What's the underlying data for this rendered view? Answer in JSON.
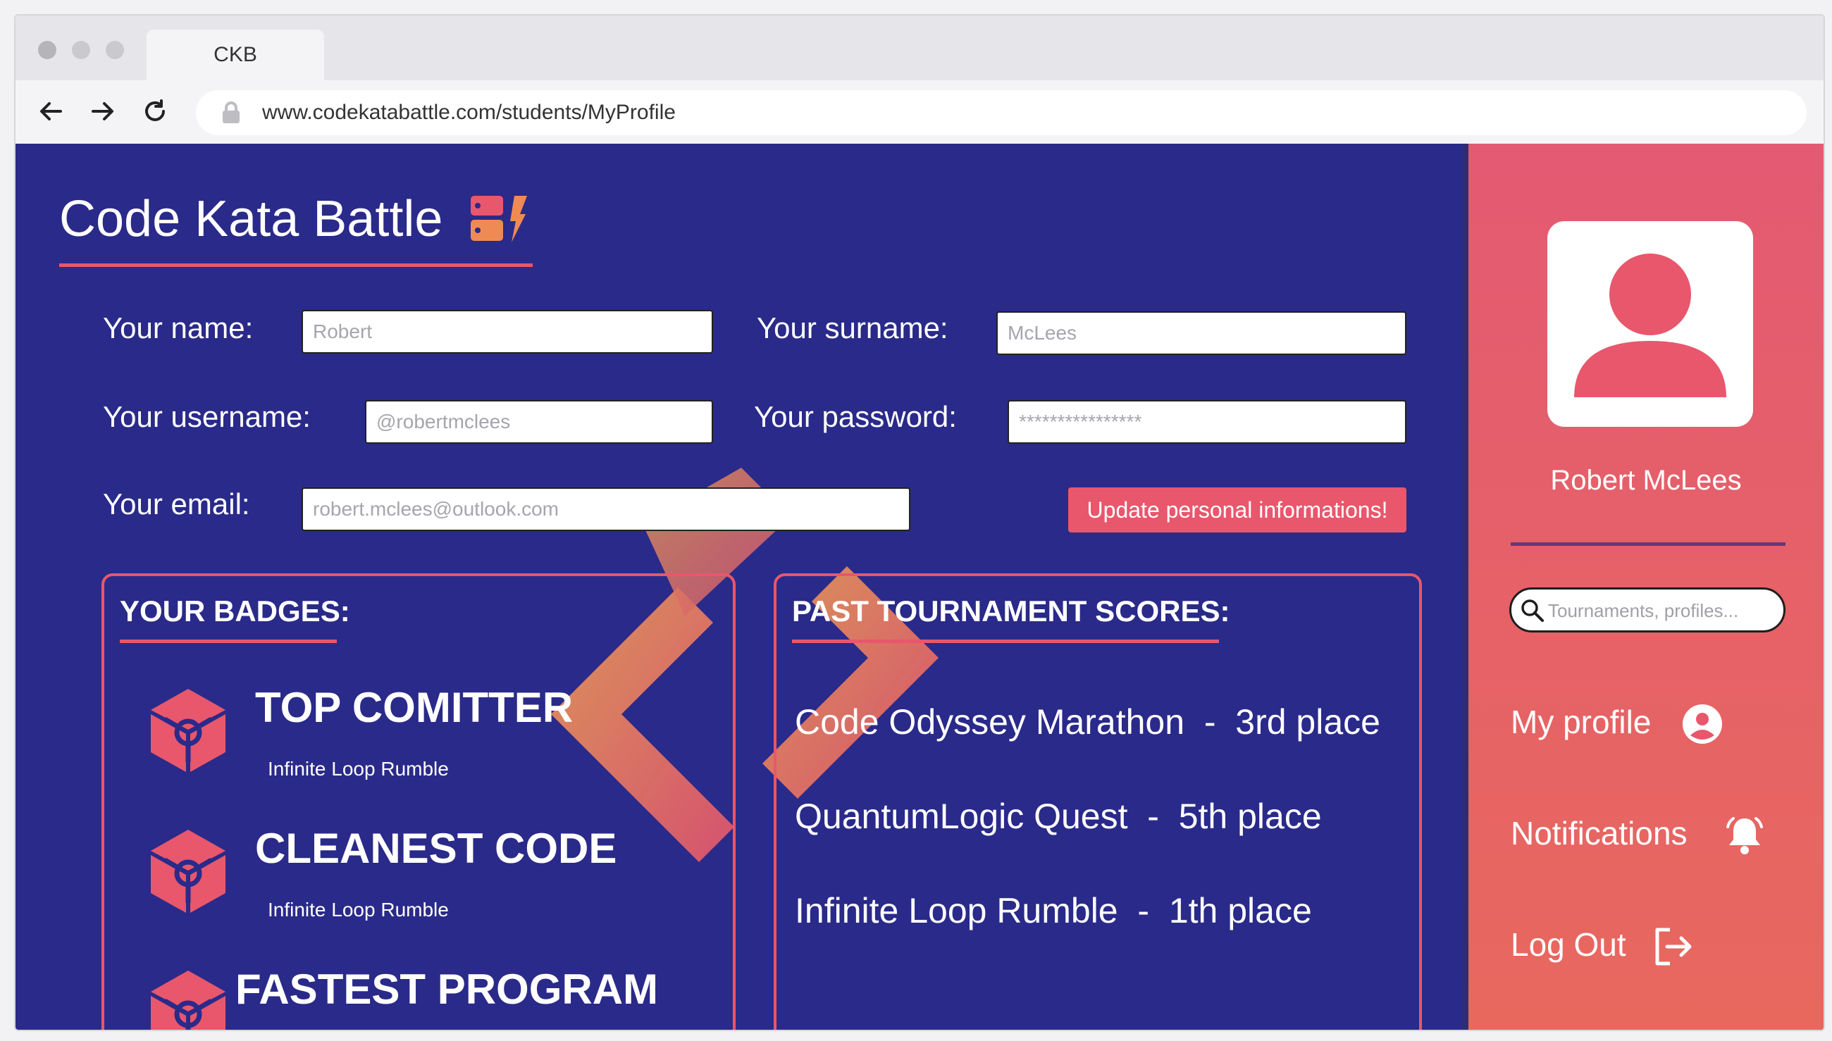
{
  "browser": {
    "tab_title": "CKB",
    "url": "www.codekatabattle.com/students/MyProfile"
  },
  "header": {
    "site_title": "Code Kata Battle"
  },
  "form": {
    "name_label": "Your name:",
    "name_value": "Robert",
    "surname_label": "Your surname:",
    "surname_value": "McLees",
    "username_label": "Your username:",
    "username_value": "@robertmclees",
    "password_label": "Your password:",
    "password_value": "****************",
    "email_label": "Your email:",
    "email_value": "robert.mclees@outlook.com",
    "update_button": "Update personal informations!"
  },
  "badges": {
    "title": "YOUR BADGES:",
    "items": [
      {
        "name": "TOP COMITTER",
        "tournament": "Infinite Loop Rumble"
      },
      {
        "name": "CLEANEST CODE",
        "tournament": "Infinite Loop Rumble"
      },
      {
        "name": "FASTEST PROGRAM",
        "tournament": ""
      }
    ]
  },
  "scores": {
    "title": "PAST TOURNAMENT SCORES:",
    "items": [
      "Code Odyssey Marathon  -  3rd place",
      "QuantumLogic Quest  -  5th place",
      "Infinite Loop Rumble  -  1th place"
    ]
  },
  "sidebar": {
    "user_name": "Robert McLees",
    "search_placeholder": "Tournaments, profiles...",
    "nav": [
      {
        "label": "My profile",
        "icon": "user-circle-icon"
      },
      {
        "label": "Notifications",
        "icon": "bell-icon"
      },
      {
        "label": "Log Out",
        "icon": "logout-icon"
      }
    ]
  },
  "colors": {
    "page_background": "#2a2a8a",
    "accent": "#e8576c",
    "sidebar_gradient_top": "#e35a72",
    "sidebar_gradient_bottom": "#e8685e"
  }
}
